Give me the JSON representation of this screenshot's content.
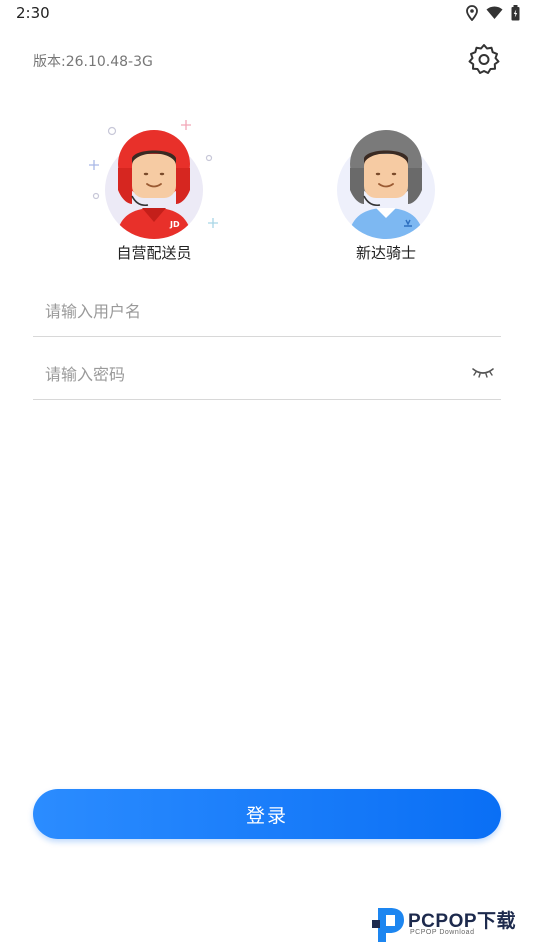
{
  "status_bar": {
    "time": "2:30"
  },
  "header": {
    "version": "版本:26.10.48-3G"
  },
  "roles": [
    {
      "label": "自营配送员",
      "badge": "JD",
      "color": "#e8302a"
    },
    {
      "label": "新达骑士",
      "color": "#7a7a7a"
    }
  ],
  "form": {
    "username_placeholder": "请输入用户名",
    "password_placeholder": "请输入密码"
  },
  "login_label": "登录",
  "watermark": {
    "brand": "PCPOP下载",
    "sub": "PCPOP Download"
  },
  "colors": {
    "primary": "#0a6ff5",
    "jd_red": "#e8302a"
  }
}
